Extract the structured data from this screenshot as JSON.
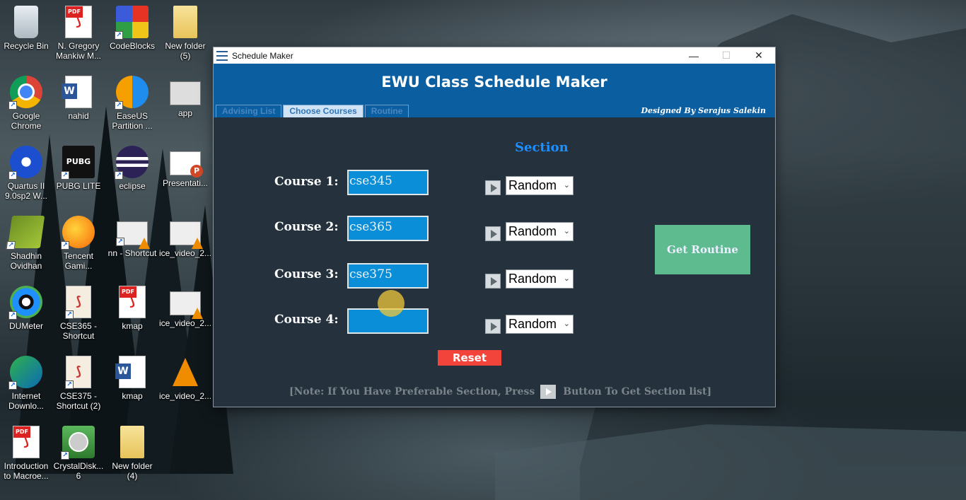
{
  "desktop": {
    "icons": [
      {
        "label": "Recycle Bin",
        "icon": "recycle-bin-icon"
      },
      {
        "label": "N. Gregory Mankiw M...",
        "icon": "pdf-icon"
      },
      {
        "label": "CodeBlocks",
        "icon": "codeblocks-icon"
      },
      {
        "label": "New folder (5)",
        "icon": "folder-icon"
      },
      {
        "label": "Google Chrome",
        "icon": "chrome-icon"
      },
      {
        "label": "nahid",
        "icon": "word-icon"
      },
      {
        "label": "EaseUS Partition ...",
        "icon": "easeus-icon"
      },
      {
        "label": "app",
        "icon": "app-icon"
      },
      {
        "label": "Quartus II 9.0sp2 W...",
        "icon": "quartus-icon"
      },
      {
        "label": "PUBG LITE",
        "icon": "pubg-icon"
      },
      {
        "label": "eclipse",
        "icon": "eclipse-icon"
      },
      {
        "label": "Presentati...",
        "icon": "powerpoint-icon"
      },
      {
        "label": "Shadhin Ovidhan",
        "icon": "book-icon"
      },
      {
        "label": "Tencent Gami...",
        "icon": "tencent-icon"
      },
      {
        "label": "nn - Shortcut",
        "icon": "video-icon"
      },
      {
        "label": "ice_video_2...",
        "icon": "video-icon"
      },
      {
        "label": "DUMeter",
        "icon": "dumeter-icon"
      },
      {
        "label": "CSE365 - Shortcut",
        "icon": "pdf-shortcut-icon"
      },
      {
        "label": "kmap",
        "icon": "pdf-icon"
      },
      {
        "label": "ice_video_2...",
        "icon": "video-icon"
      },
      {
        "label": "Internet Downlo...",
        "icon": "idm-icon"
      },
      {
        "label": "CSE375 - Shortcut (2)",
        "icon": "pdf-shortcut-icon"
      },
      {
        "label": "kmap",
        "icon": "word-icon"
      },
      {
        "label": "ice_video_2...",
        "icon": "vlc-icon"
      },
      {
        "label": "Introduction to Macroe...",
        "icon": "pdf-icon"
      },
      {
        "label": "CrystalDisk... 6",
        "icon": "crystaldisk-icon"
      },
      {
        "label": "New folder (4)",
        "icon": "folder-icon"
      }
    ]
  },
  "window": {
    "title": "Schedule Maker",
    "minimize": "—",
    "maximize": "☐",
    "close": "✕",
    "header_title": "EWU Class Schedule Maker",
    "designed_by": "Designed By Serajus Salekin",
    "tabs": [
      {
        "label": "Advising List",
        "active": false
      },
      {
        "label": "Choose Courses",
        "active": true
      },
      {
        "label": "Routine",
        "active": false
      }
    ]
  },
  "form": {
    "section_heading": "Section",
    "courses": [
      {
        "label": "Course 1:",
        "value": "cse345",
        "section": "Random"
      },
      {
        "label": "Course 2:",
        "value": "cse365",
        "section": "Random"
      },
      {
        "label": "Course 3:",
        "value": "cse375",
        "section": "Random"
      },
      {
        "label": "Course 4:",
        "value": "",
        "section": "Random"
      }
    ],
    "get_routine_label": "Get Routine",
    "reset_label": "Reset",
    "note_before": "[Note:  If You Have Preferable Section, Press",
    "note_after": "Button To Get Section list]"
  },
  "colors": {
    "header_blue": "#0b5fa0",
    "panel_bg": "#25323d",
    "input_blue": "#0a8ed8",
    "section_heading": "#1e8fff",
    "get_routine_green": "#5dbb8f",
    "reset_red": "#f2443b"
  }
}
